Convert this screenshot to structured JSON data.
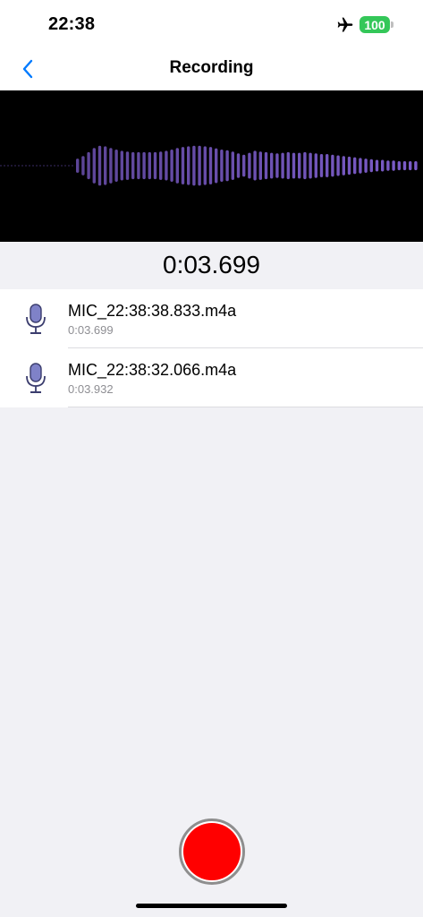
{
  "status_bar": {
    "time": "22:38",
    "battery_level": "100",
    "airplane_mode_icon": "airplane-icon",
    "battery_color": "#34c759"
  },
  "nav": {
    "title": "Recording",
    "back_icon": "chevron-left-icon",
    "accent_color": "#007aff"
  },
  "waveform": {
    "bar_color": "#7b5cc9",
    "background": "#000000",
    "bar_amplitudes": [
      0.22,
      0.3,
      0.42,
      0.55,
      0.62,
      0.6,
      0.55,
      0.5,
      0.46,
      0.44,
      0.42,
      0.42,
      0.42,
      0.42,
      0.42,
      0.44,
      0.46,
      0.5,
      0.55,
      0.58,
      0.6,
      0.62,
      0.62,
      0.6,
      0.58,
      0.54,
      0.5,
      0.48,
      0.44,
      0.38,
      0.34,
      0.4,
      0.46,
      0.44,
      0.42,
      0.4,
      0.38,
      0.4,
      0.42,
      0.4,
      0.4,
      0.42,
      0.4,
      0.38,
      0.36,
      0.36,
      0.34,
      0.32,
      0.3,
      0.28,
      0.26,
      0.24,
      0.22,
      0.2,
      0.18,
      0.18,
      0.16,
      0.16,
      0.14,
      0.14,
      0.14,
      0.14
    ]
  },
  "timer": "0:03.699",
  "recordings": [
    {
      "name": "MIC_22:38:38.833.m4a",
      "duration": "0:03.699",
      "icon": "microphone-icon"
    },
    {
      "name": "MIC_22:38:32.066.m4a",
      "duration": "0:03.932",
      "icon": "microphone-icon"
    }
  ],
  "record_button": {
    "icon": "record-icon",
    "color": "#ff0000"
  }
}
